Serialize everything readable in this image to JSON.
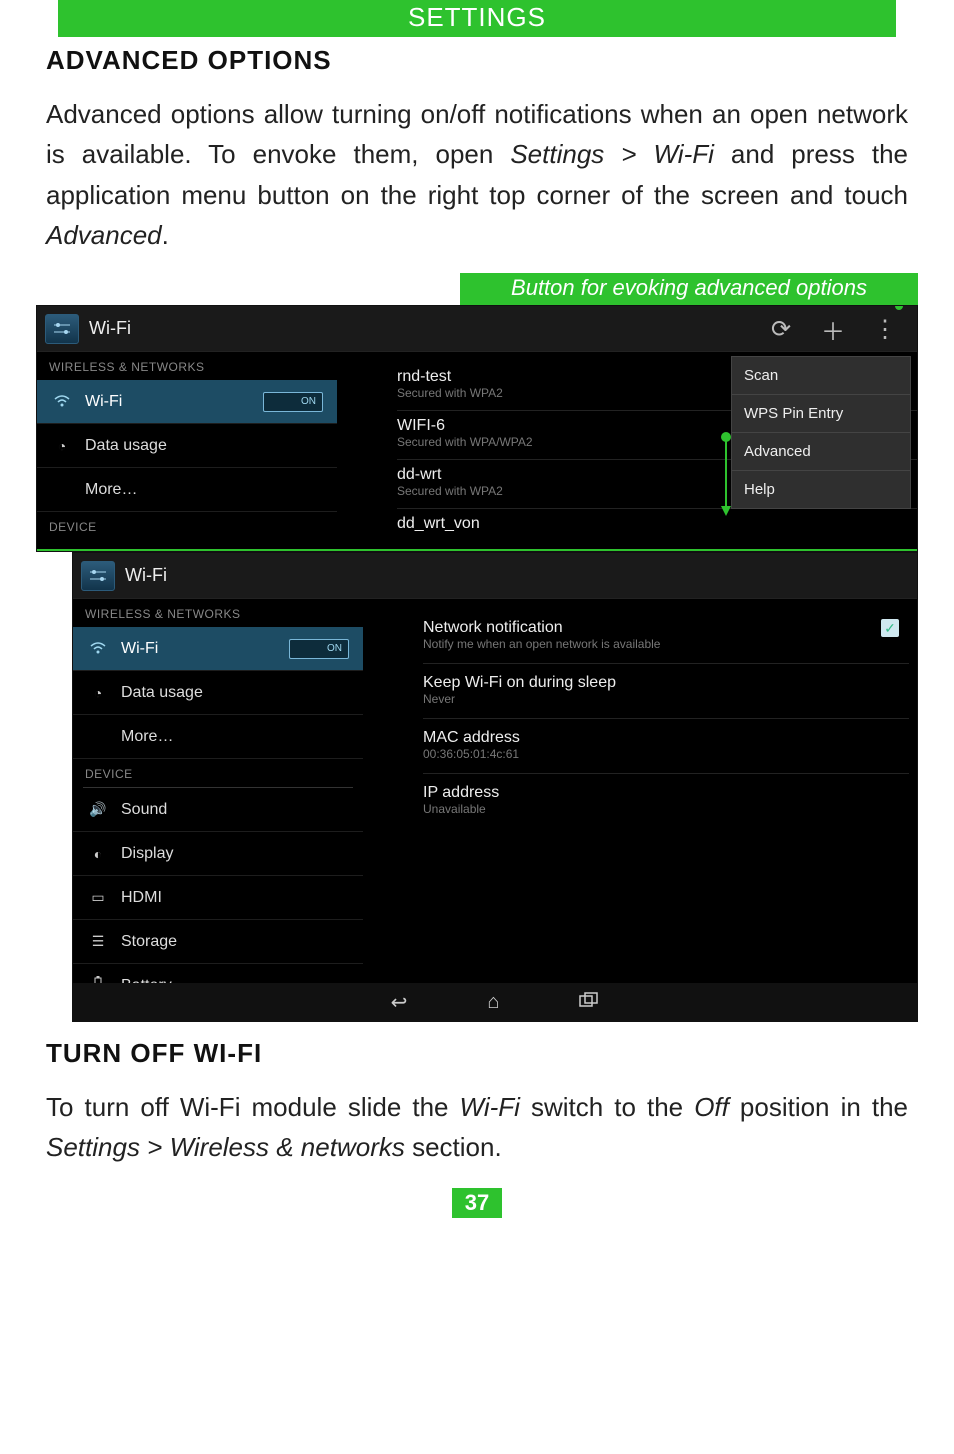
{
  "header": "SETTINGS",
  "section1_title": "ADVANCED OPTIONS",
  "para1_a": "Advanced options allow turning on/off notifications when an open network is available. To envoke them, open ",
  "para1_path": "Settings > Wi-Fi",
  "para1_b": " and press the application menu button on the right top corner of the screen and touch ",
  "para1_adv": "Advanced",
  "para1_c": ".",
  "callout": "Button for evoking advanced options",
  "shot1": {
    "title": "Wi-Fi",
    "section_wireless": "WIRELESS & NETWORKS",
    "sb_wifi": "Wi-Fi",
    "toggle": "ON",
    "sb_data": "Data usage",
    "sb_more": "More…",
    "section_device": "DEVICE",
    "networks": [
      {
        "name": "rnd-test",
        "sub": "Secured with WPA2"
      },
      {
        "name": "WIFI-6",
        "sub": "Secured with WPA/WPA2"
      },
      {
        "name": "dd-wrt",
        "sub": "Secured with WPA2"
      },
      {
        "name": "dd_wrt_von",
        "sub": ""
      }
    ],
    "menu": {
      "scan": "Scan",
      "wps": "WPS Pin Entry",
      "advanced": "Advanced",
      "help": "Help"
    }
  },
  "shot2": {
    "title": "Wi-Fi",
    "section_wireless": "WIRELESS & NETWORKS",
    "sb_wifi": "Wi-Fi",
    "toggle": "ON",
    "sb_data": "Data usage",
    "sb_more": "More…",
    "section_device": "DEVICE",
    "sb_sound": "Sound",
    "sb_display": "Display",
    "sb_hdmi": "HDMI",
    "sb_storage": "Storage",
    "sb_battery": "Battery",
    "adv": {
      "netnotif_t": "Network notification",
      "netnotif_s": "Notify me when an open network is available",
      "keep_t": "Keep Wi-Fi on during sleep",
      "keep_s": "Never",
      "mac_t": "MAC address",
      "mac_s": "00:36:05:01:4c:61",
      "ip_t": "IP address",
      "ip_s": "Unavailable"
    }
  },
  "section2_title": "TURN OFF WI-FI",
  "para2_a": "To turn off Wi-Fi module slide the ",
  "para2_wifi": "Wi-Fi",
  "para2_b": " switch to the ",
  "para2_off": "Off",
  "para2_c": " position in the ",
  "para2_path": "Settings > Wireless & networks",
  "para2_d": " section.",
  "page_number": "37"
}
